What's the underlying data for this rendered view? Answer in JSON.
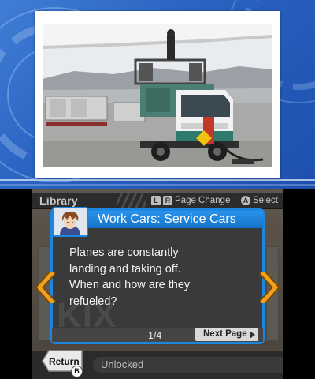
{
  "top_screen": {
    "photo": {
      "subject": "service-car"
    }
  },
  "header": {
    "title": "Library",
    "hints": [
      {
        "keys": [
          "L",
          "R"
        ],
        "label": "Page Change"
      },
      {
        "keys": [
          "A"
        ],
        "label": "Select"
      }
    ]
  },
  "dialog": {
    "title": "Work Cars: Service Cars",
    "body_lines": [
      "Planes are constantly",
      "landing and taking off.",
      "When and how are they",
      "refueled?"
    ],
    "watermark": "KIX",
    "page_indicator": "1/4",
    "next_label": "Next Page"
  },
  "footer": {
    "return_label": "Return",
    "return_key": "B",
    "status_text": "Unlocked"
  },
  "colors": {
    "accent_blue": "#1d86e0",
    "arrow_orange": "#f0a020",
    "top_bg": "#2f6bc8"
  }
}
